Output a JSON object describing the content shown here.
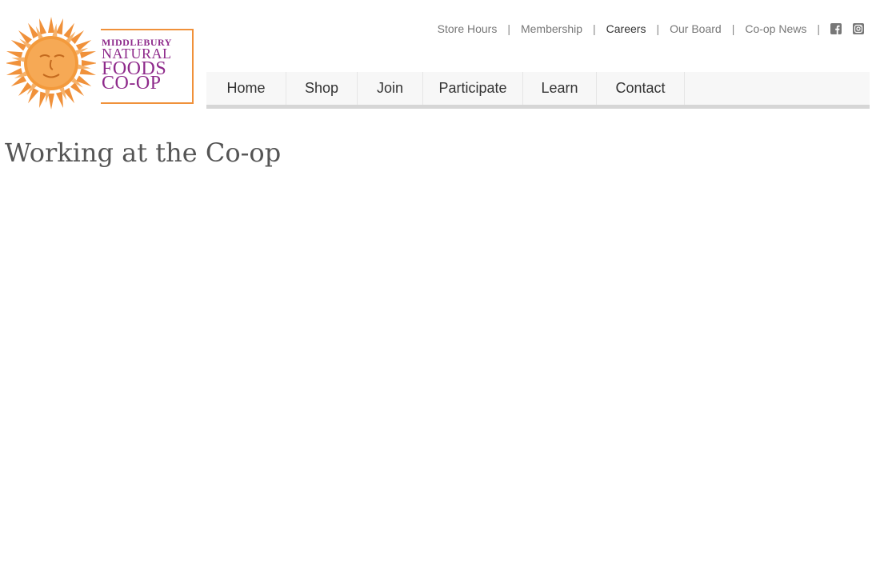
{
  "logo": {
    "line1": "MIDDLEBURY",
    "line2": "NATURAL",
    "line3": "FOODS",
    "line4": "CO-OP",
    "colors": {
      "sun": "#f0913a",
      "text": "#8e2a8b",
      "leaf": "#5aa53a"
    }
  },
  "utility_nav": {
    "items": [
      {
        "label": "Store Hours",
        "active": false
      },
      {
        "label": "Membership",
        "active": false
      },
      {
        "label": "Careers",
        "active": true
      },
      {
        "label": "Our Board",
        "active": false
      },
      {
        "label": "Co-op News",
        "active": false
      }
    ],
    "separator": "|",
    "social": [
      {
        "icon": "facebook-icon"
      },
      {
        "icon": "instagram-icon"
      }
    ]
  },
  "main_nav": {
    "items": [
      {
        "label": "Home"
      },
      {
        "label": "Shop"
      },
      {
        "label": "Join"
      },
      {
        "label": "Participate"
      },
      {
        "label": "Learn"
      },
      {
        "label": "Contact"
      }
    ]
  },
  "page": {
    "title": "Working at the Co-op"
  }
}
